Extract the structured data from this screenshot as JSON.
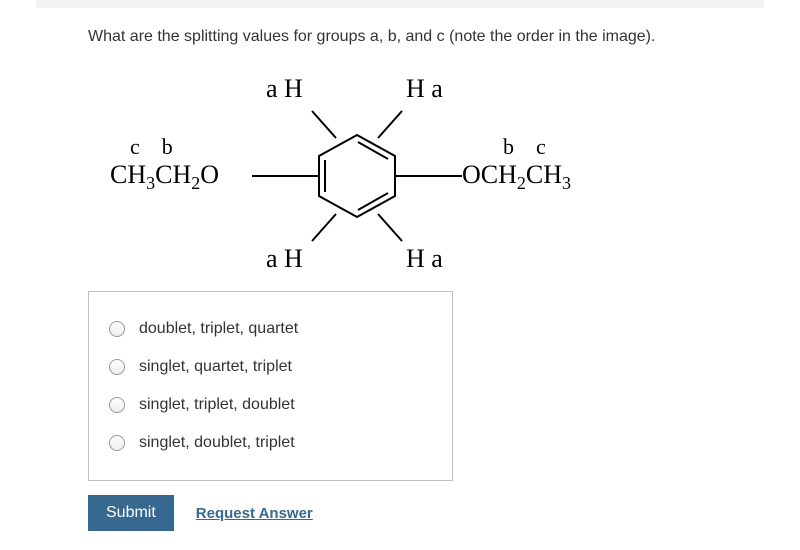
{
  "question": "What are the splitting values for groups a, b, and c (note the order in the image).",
  "structure": {
    "top_left_aH": "a H",
    "top_right_Ha": "H a",
    "left_cb": "c    b",
    "right_bc": "b    c",
    "left_group": "CH₃CH₂O",
    "right_group": "OCH₂CH₃",
    "bottom_left_aH": "a H",
    "bottom_right_Ha": "H a"
  },
  "options": [
    {
      "label": "doublet, triplet, quartet"
    },
    {
      "label": "singlet, quartet, triplet"
    },
    {
      "label": "singlet, triplet, doublet"
    },
    {
      "label": "singlet, doublet, triplet"
    }
  ],
  "buttons": {
    "submit": "Submit",
    "request": "Request Answer"
  }
}
